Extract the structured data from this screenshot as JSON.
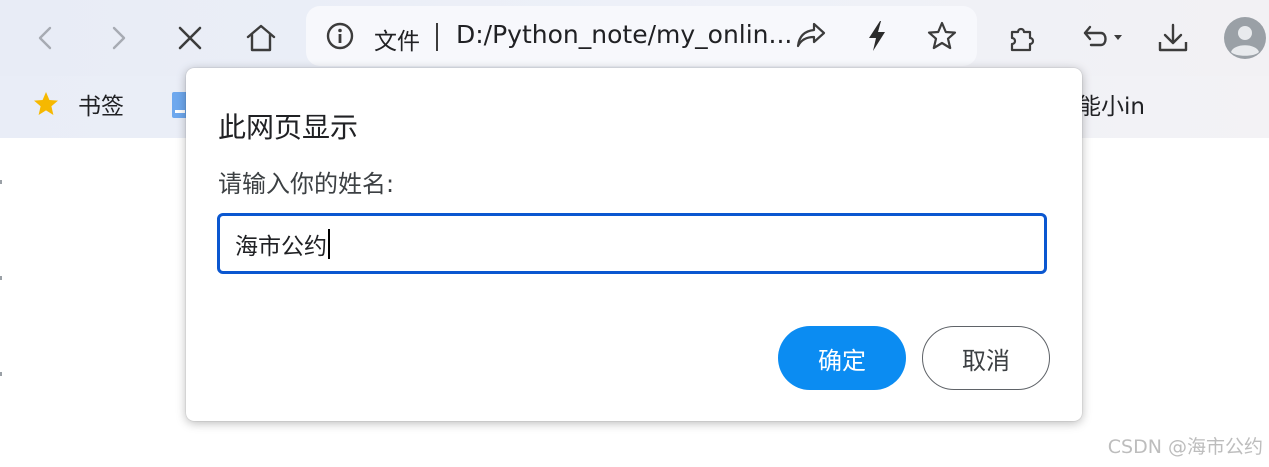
{
  "toolbar": {
    "omnibox": {
      "scheme_label": "文件",
      "url": "D:/Python_note/my_onlin..."
    }
  },
  "bookmarks": {
    "items": [
      {
        "label": "书签",
        "icon": "star-icon"
      },
      {
        "label": "",
        "icon": "folder-icon"
      },
      {
        "label": "能小in",
        "icon": ""
      }
    ]
  },
  "dialog": {
    "title": "此网页显示",
    "message": "请输入你的姓名:",
    "input_value": "海市公约",
    "ok_label": "确定",
    "cancel_label": "取消"
  },
  "watermark": "CSDN @海市公约",
  "colors": {
    "accent": "#0b8cf2",
    "focus_border": "#0b57d0",
    "chrome_bg": "#eef1f8"
  }
}
